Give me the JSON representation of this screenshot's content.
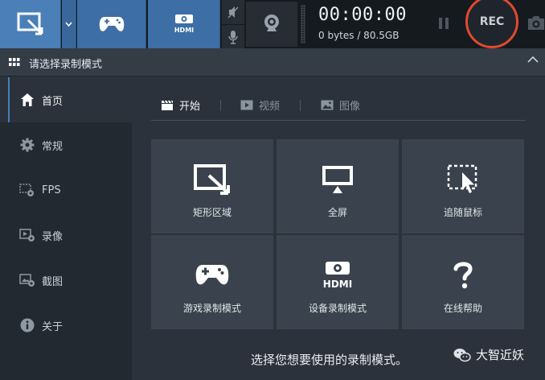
{
  "toolbar": {
    "modes": [
      {
        "icon": "rectangle-area-icon",
        "active": true
      },
      {
        "icon": "chevron-down-icon"
      },
      {
        "icon": "gamepad-icon"
      },
      {
        "icon": "hdmi-icon",
        "label": "HDMI"
      }
    ],
    "timer": "00:00:00",
    "storage": "0 bytes / 80.5GB",
    "rec_label": "REC",
    "hdmi_label": "HDMI"
  },
  "header": {
    "title": "请选择录制模式"
  },
  "sidebar": {
    "items": [
      {
        "label": "首页",
        "icon": "home-icon",
        "active": true
      },
      {
        "label": "常规",
        "icon": "gear-icon"
      },
      {
        "label": "FPS",
        "icon": "fps-settings-icon"
      },
      {
        "label": "录像",
        "icon": "video-settings-icon"
      },
      {
        "label": "截图",
        "icon": "image-settings-icon"
      },
      {
        "label": "关于",
        "icon": "info-icon"
      }
    ]
  },
  "tabs": [
    {
      "label": "开始",
      "icon": "clapperboard-icon",
      "active": true
    },
    {
      "label": "视频",
      "icon": "play-icon"
    },
    {
      "label": "图像",
      "icon": "picture-icon"
    }
  ],
  "tiles": [
    {
      "label": "矩形区域",
      "icon": "rectangle-area-icon"
    },
    {
      "label": "全屏",
      "icon": "monitor-icon"
    },
    {
      "label": "追随鼠标",
      "icon": "follow-mouse-icon"
    },
    {
      "label": "游戏录制模式",
      "icon": "gamepad-icon"
    },
    {
      "label": "设备录制模式",
      "icon": "hdmi-device-icon"
    },
    {
      "label": "在线帮助",
      "icon": "question-icon"
    }
  ],
  "hint": "选择您想要使用的录制模式。",
  "watermark": "大智近妖",
  "colors": {
    "accent": "#3d6ea5",
    "rec_ring": "#e0492f",
    "tile_bg": "#3a434d",
    "sidebar_bg": "#232930"
  }
}
